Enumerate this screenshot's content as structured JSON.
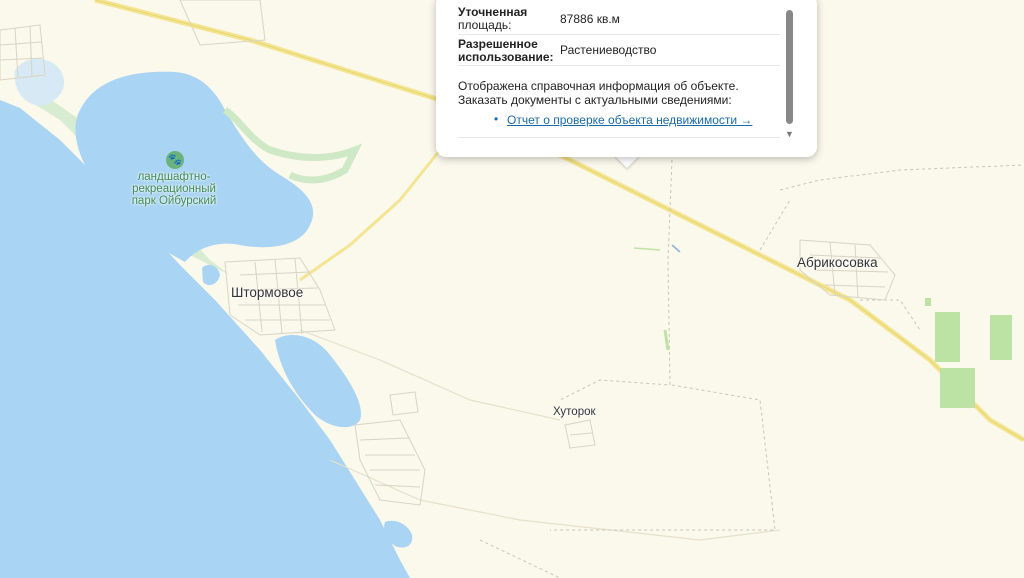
{
  "map": {
    "places": {
      "park": "ландшафтно-рекреационный парк Ойбурский",
      "park_line1": "ландшафтно-",
      "park_line2": "рекреационный",
      "park_line3": "парк Ойбурский",
      "shtormovoe": "Штормовое",
      "abrikosovka": "Абрикосовка",
      "khutorok": "Хуторок"
    },
    "colors": {
      "sea": "#a7d3f2",
      "land": "#fbf8ec",
      "road": "#f4e58c",
      "green": "#cfe8c6",
      "field": "#bfe3a6"
    }
  },
  "popup": {
    "area_label": "Уточненная площадь:",
    "area_label_line1": "Уточненная",
    "area_label_line2": "площадь:",
    "area_value": "87886 кв.м",
    "use_label_line1": "Разрешенное",
    "use_label_line2": "использование:",
    "use_value": "Растениеводство",
    "info_line1": "Отображена справочная информация об объекте.",
    "info_line2": "Заказать документы с актуальными сведениями:",
    "report_link": "Отчет о проверке объекта недвижимости →"
  }
}
